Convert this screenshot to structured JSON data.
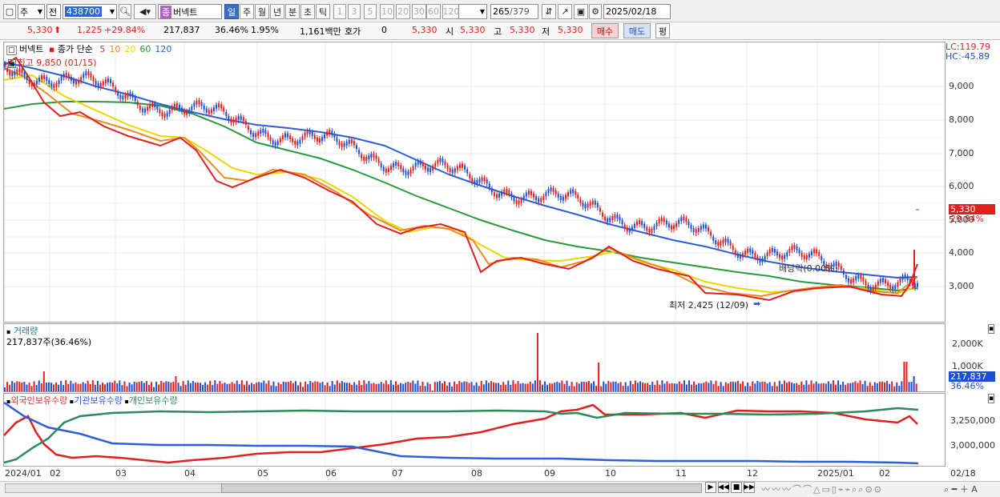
{
  "toolbar": {
    "market": "주",
    "prev_label": "전",
    "code": "438700",
    "name_badge": "종",
    "name": "버넥트",
    "periods": [
      "일",
      "주",
      "월",
      "년",
      "분",
      "초",
      "틱"
    ],
    "active_period": "일",
    "intervals": [
      "1",
      "3",
      "5",
      "10",
      "20",
      "30",
      "60",
      "120"
    ],
    "count": "265",
    "total": "/379",
    "date": "2025/02/18"
  },
  "quote": {
    "price": "5,330",
    "change": "1,225",
    "change_pct": "+29.84%",
    "volume": "217,837",
    "volume_ratio": "36.46%",
    "turnover": "1.95%",
    "amount": "1,161백만",
    "hoga_label": "호가",
    "hoga": "0",
    "close": "5,330",
    "open_label": "시",
    "open": "5,330",
    "high_label": "고",
    "high": "5,330",
    "low_label": "저",
    "low": "5,330",
    "buy": "매수",
    "sell": "매도",
    "eval": "평"
  },
  "price_panel": {
    "title": "버넥트",
    "ma_label": "종가 단순",
    "ma_periods": [
      {
        "p": "5",
        "color": "#e03030"
      },
      {
        "p": "10",
        "color": "#f08a20"
      },
      {
        "p": "20",
        "color": "#e8d800"
      },
      {
        "p": "60",
        "color": "#2a9a3a"
      },
      {
        "p": "120",
        "color": "#2f5fd8"
      }
    ],
    "high_note": "최고 9,850 (01/15)",
    "low_note": "최저 2,425 (12/09)",
    "dividend_note": "배당락(0.00%)",
    "lc": "LC:119.79",
    "hc": "HC:-45.89",
    "price_tag": "5,330",
    "pct_tag": "29.84%",
    "yticks": [
      "9,000",
      "8,000",
      "7,000",
      "6,000",
      "5,000",
      "4,000",
      "3,000"
    ]
  },
  "volume_panel": {
    "title": "거래량",
    "value": "217,837주(36.46%)",
    "yticks": [
      "2,000K",
      "1,000K"
    ],
    "tag": "217,837",
    "tag_pct": "36.46%"
  },
  "holding_panel": {
    "legend": [
      "외국인보유수량",
      "기관보유수량",
      "개인보유수량"
    ],
    "colors": [
      "#e03030",
      "#2f5fd8",
      "#2a8a5a"
    ],
    "yticks": [
      "3,250,000",
      "3,000,000"
    ]
  },
  "xaxis": [
    "2024/01",
    "02",
    "03",
    "04",
    "05",
    "06",
    "07",
    "08",
    "09",
    "10",
    "11",
    "12",
    "2025/01",
    "02"
  ],
  "xaxis_end": "02/18",
  "colors": {
    "up": "#e02020",
    "down": "#1f4fd0",
    "accent": "#3d6fc0"
  }
}
